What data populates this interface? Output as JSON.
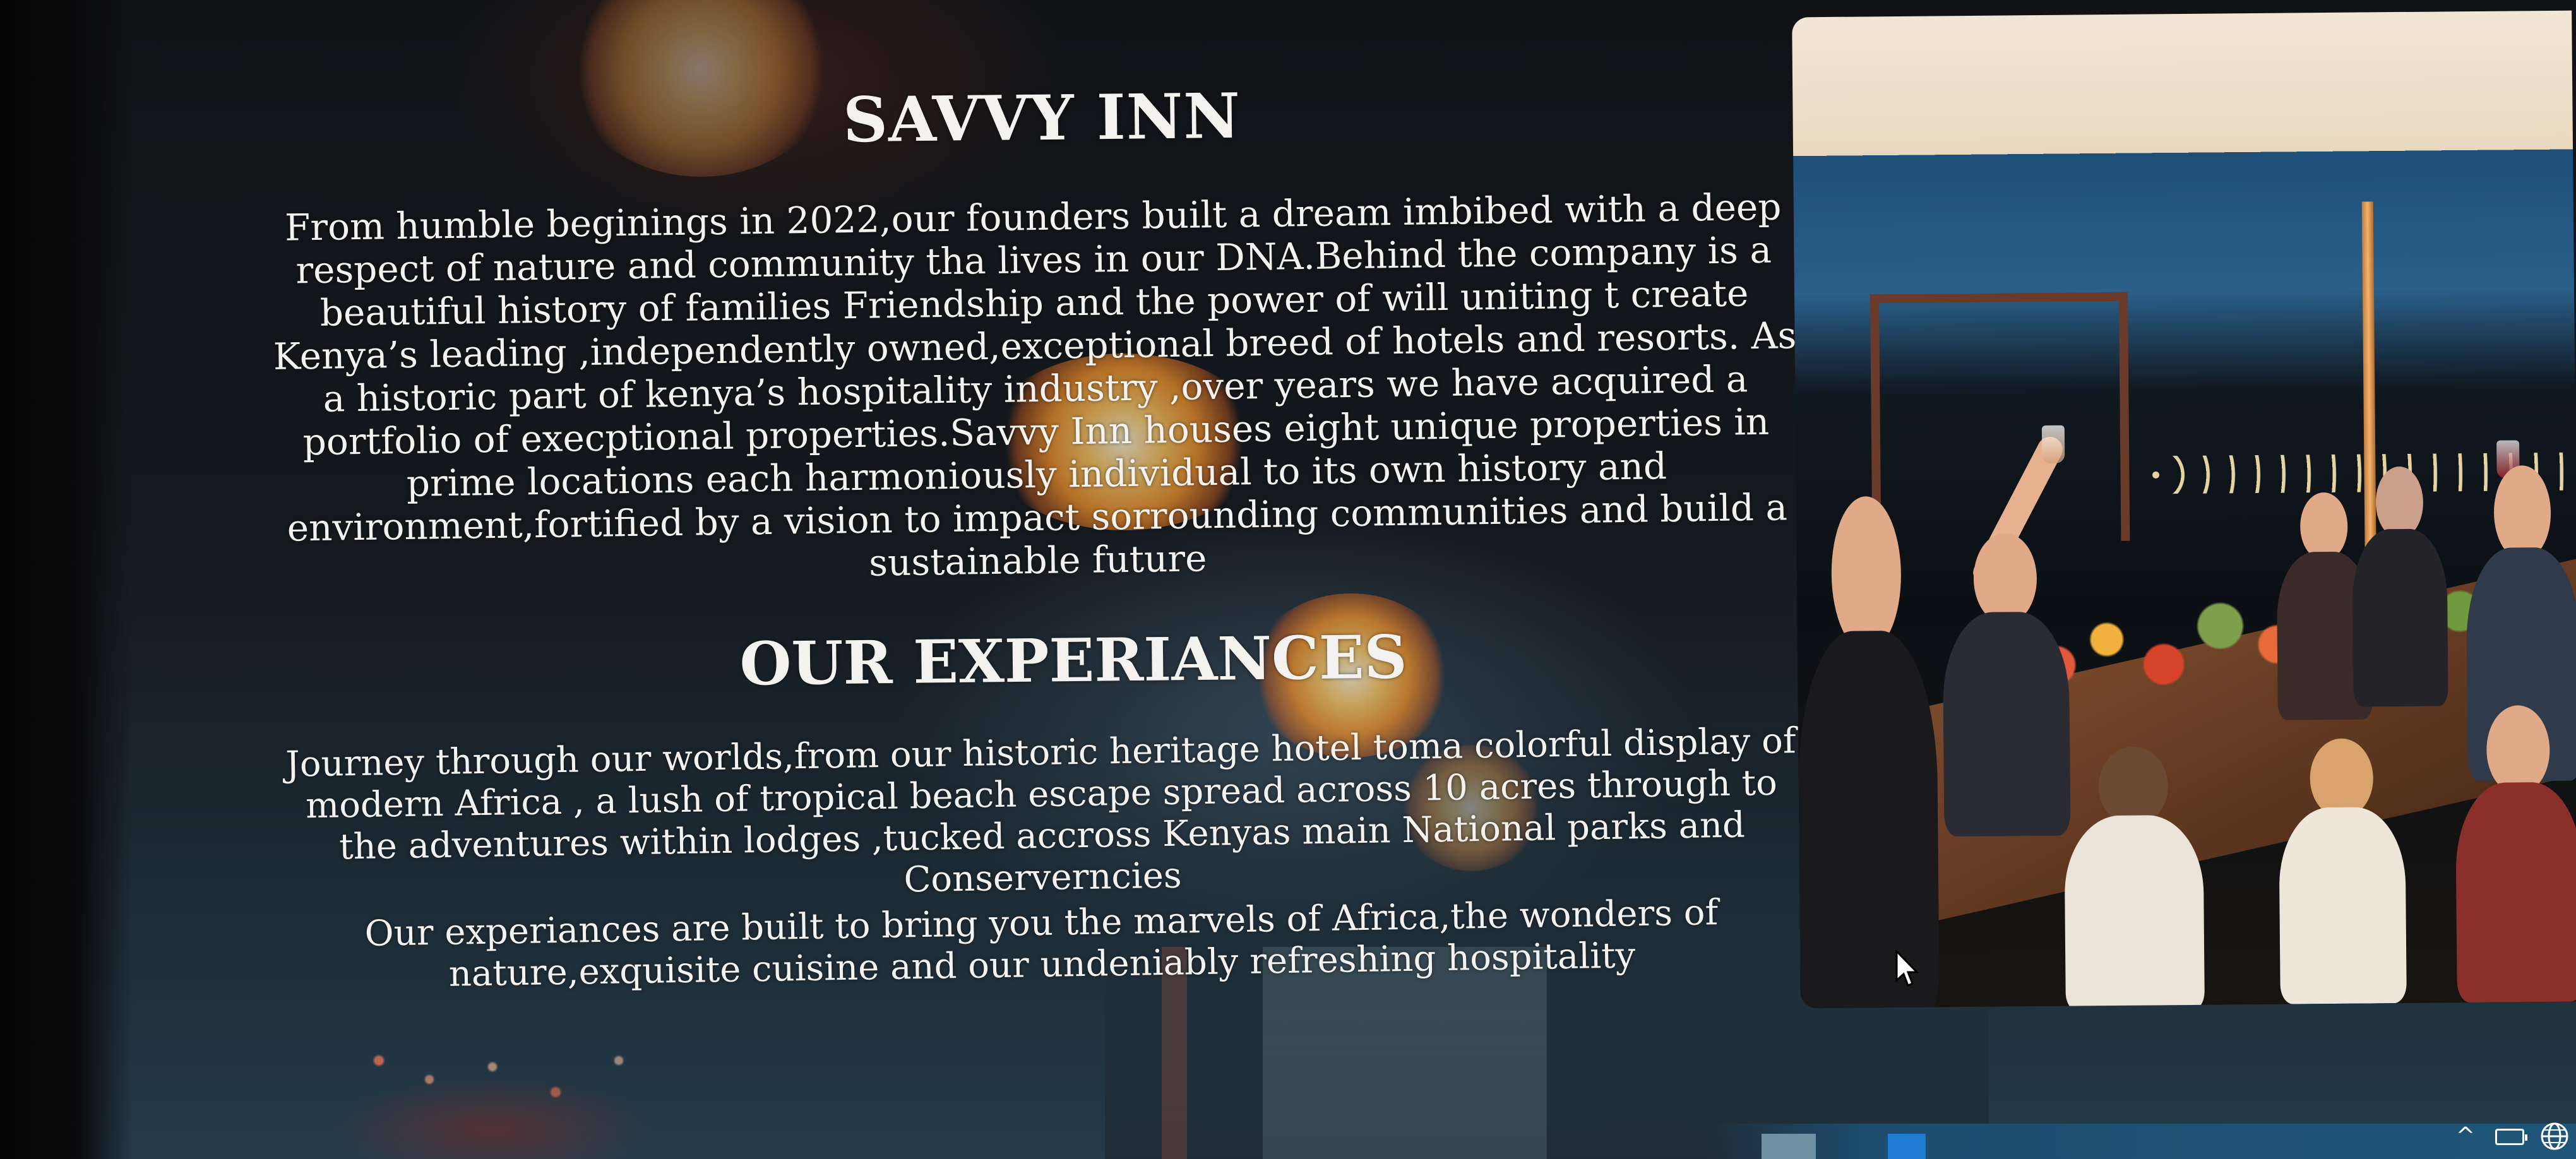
{
  "page": {
    "title": "SAVVY INN",
    "intro": "From humble beginings in 2022,our founders built a dream imbibed with a deep respect of nature and community tha lives in our DNA.Behind the company is a beautiful history of families Friendship and the power of will uniting t create Kenya’s leading ,independently owned,exceptional breed of hotels and resorts. As a historic part of kenya’s hospitality industry ,over years we have acquired a portfolio of execptional properties.Savvy Inn houses eight unique properties in prime locations each harmoniously individual to its own history and environment,fortified by a vision to impact sorrounding communities and build a sustainable future",
    "experiences_heading": "OUR EXPERIANCES",
    "experiences_p1": "Journey through our worlds,from our historic heritage hotel toma colorful display of modern Africa , a lush of tropical beach escape spread across 10 acres through to the adventures within lodges ,tucked accross Kenyas main National parks and Conserverncies",
    "experiences_p2": "Our experiances are built to bring you the marvels of Africa,the wonders of nature,exquisite cuisine and our undeniably refreshing hospitality"
  },
  "taskbar": {
    "tray_icons": [
      "chevron-up-icon",
      "battery-icon",
      "globe-icon"
    ]
  },
  "colors": {
    "text": "#f4f2ee",
    "background": "#101216",
    "taskbar": "#1e5578",
    "accent_flower": "#f2c064"
  }
}
